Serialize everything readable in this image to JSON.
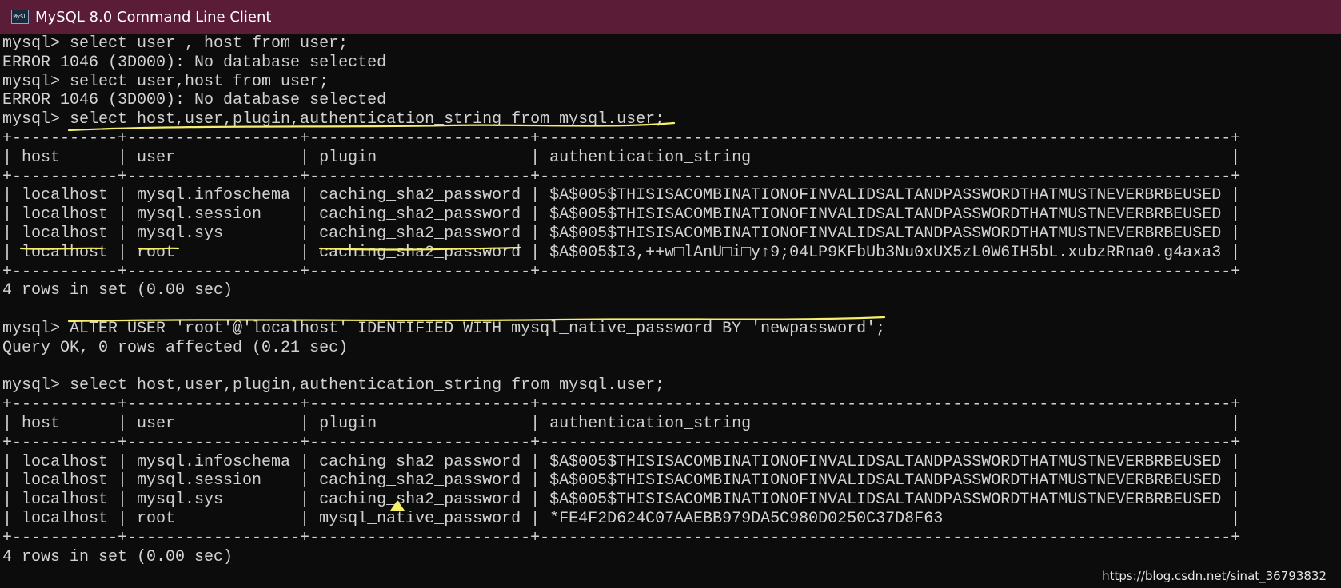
{
  "window": {
    "title": "MySQL 8.0 Command Line Client",
    "icon": "mysql-console-icon",
    "icon_text": "MySL",
    "titlebar_color": "#5a1c36",
    "background_color": "#0c0c0c",
    "text_color": "#d2d2d2",
    "annotation_color": "#f5ef6a"
  },
  "console": {
    "lines": [
      "mysql> select user , host from user;",
      "ERROR 1046 (3D000): No database selected",
      "mysql> select user,host from user;",
      "ERROR 1046 (3D000): No database selected",
      "mysql> select host,user,plugin,authentication_string from mysql.user;",
      "+-----------+------------------+-----------------------+------------------------------------------------------------------------+",
      "| host      | user             | plugin                | authentication_string                                                  |",
      "+-----------+------------------+-----------------------+------------------------------------------------------------------------+",
      "| localhost | mysql.infoschema | caching_sha2_password | $A$005$THISISACOMBINATIONOFINVALIDSALTANDPASSWORDTHATMUSTNEVERBRBEUSED |",
      "| localhost | mysql.session    | caching_sha2_password | $A$005$THISISACOMBINATIONOFINVALIDSALTANDPASSWORDTHATMUSTNEVERBRBEUSED |",
      "| localhost | mysql.sys        | caching_sha2_password | $A$005$THISISACOMBINATIONOFINVALIDSALTANDPASSWORDTHATMUSTNEVERBRBEUSED |",
      "| localhost | root             | caching_sha2_password | $A$005$I3,++w□lAnU□i□y↑9;04LP9KFbUb3Nu0xUX5zL0W6IH5bL.xubzRRna0.g4axa3 |",
      "+-----------+------------------+-----------------------+------------------------------------------------------------------------+",
      "4 rows in set (0.00 sec)",
      "",
      "mysql> ALTER USER 'root'@'localhost' IDENTIFIED WITH mysql_native_password BY 'newpassword';",
      "Query OK, 0 rows affected (0.21 sec)",
      "",
      "mysql> select host,user,plugin,authentication_string from mysql.user;",
      "+-----------+------------------+-----------------------+------------------------------------------------------------------------+",
      "| host      | user             | plugin                | authentication_string                                                  |",
      "+-----------+------------------+-----------------------+------------------------------------------------------------------------+",
      "| localhost | mysql.infoschema | caching_sha2_password | $A$005$THISISACOMBINATIONOFINVALIDSALTANDPASSWORDTHATMUSTNEVERBRBEUSED |",
      "| localhost | mysql.session    | caching_sha2_password | $A$005$THISISACOMBINATIONOFINVALIDSALTANDPASSWORDTHATMUSTNEVERBRBEUSED |",
      "| localhost | mysql.sys        | caching_sha2_password | $A$005$THISISACOMBINATIONOFINVALIDSALTANDPASSWORDTHATMUSTNEVERBRBEUSED |",
      "| localhost | root             | mysql_native_password | *FE4F2D624C07AAEBB979DA5C980D0250C37D8F63                              |",
      "+-----------+------------------+-----------------------+------------------------------------------------------------------------+",
      "4 rows in set (0.00 sec)"
    ]
  },
  "watermark": "https://blog.csdn.net/sinat_36793832"
}
